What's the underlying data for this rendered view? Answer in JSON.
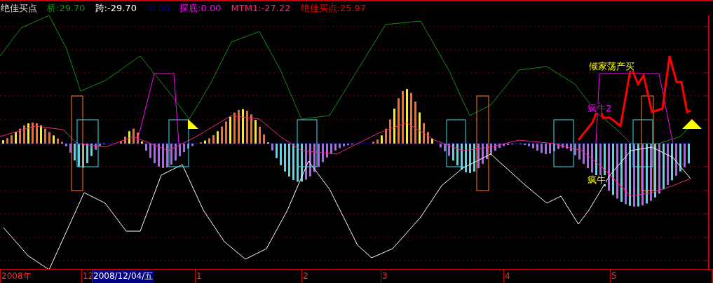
{
  "header": {
    "title": "绝佳买点",
    "values": [
      {
        "text": "桥:29.70",
        "color": "#1a8a1a"
      },
      {
        "text": "跨:-29.70",
        "color": "#ffffff"
      },
      {
        "text": ":0.00",
        "color": "#0000aa"
      },
      {
        "text": "探底:0.00",
        "color": "#ff00ff"
      },
      {
        "text": "MTM1:-27.22",
        "color": "#ff2080"
      },
      {
        "text": "绝佳买点:25.97",
        "color": "#ff0000"
      }
    ]
  },
  "chart_labels": [
    {
      "text": "倾家荡产买",
      "color": "#ffff00"
    },
    {
      "text": "疯牛2",
      "color": "#ff00ff"
    },
    {
      "text": "疯牛",
      "color": "#ffff00"
    }
  ],
  "time_axis": [
    {
      "text": "2008年",
      "selected": false
    },
    {
      "text": "12",
      "selected": false
    },
    {
      "text": "2008/12/04/五",
      "selected": true
    },
    {
      "text": "1",
      "selected": false
    },
    {
      "text": "2",
      "selected": false
    },
    {
      "text": "3",
      "selected": false
    },
    {
      "text": "4",
      "selected": false
    },
    {
      "text": "5",
      "selected": false
    }
  ]
}
